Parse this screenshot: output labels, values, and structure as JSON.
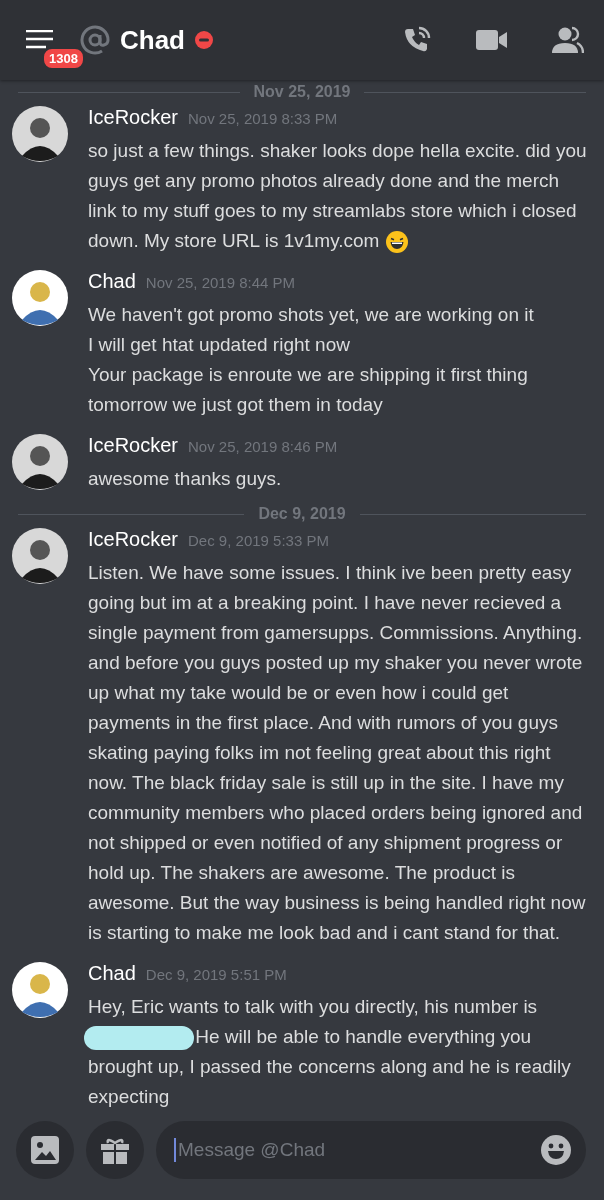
{
  "header": {
    "badge": "1308",
    "title": "Chad",
    "status": {
      "kind": "dnd"
    }
  },
  "feed": [
    {
      "kind": "date",
      "label": "Nov 25, 2019"
    },
    {
      "kind": "message",
      "author": "IceRocker",
      "avatar": {
        "kind": "grayscale"
      },
      "time": "Nov 25, 2019 8:33 PM",
      "lines": [
        [
          {
            "kind": "text",
            "text": "so just a few things. shaker looks dope hella excite. did you guys get any promo photos already done and the merch link to my stuff goes to my streamlabs store which i closed down. My store URL is 1v1my.com"
          },
          {
            "kind": "emoji"
          }
        ]
      ]
    },
    {
      "kind": "message",
      "author": "Chad",
      "avatar": {
        "kind": "color"
      },
      "time": "Nov 25, 2019 8:44 PM",
      "lines": [
        [
          {
            "kind": "text",
            "text": "We haven't got promo shots yet, we are working on it"
          }
        ],
        [
          {
            "kind": "text",
            "text": "I will get htat updated right now"
          }
        ],
        [
          {
            "kind": "text",
            "text": "Your package is enroute we are shipping it first thing tomorrow we just got them in today"
          }
        ]
      ]
    },
    {
      "kind": "message",
      "author": "IceRocker",
      "avatar": {
        "kind": "grayscale"
      },
      "time": "Nov 25, 2019 8:46 PM",
      "lines": [
        [
          {
            "kind": "text",
            "text": "awesome thanks guys."
          }
        ]
      ]
    },
    {
      "kind": "date",
      "label": "Dec 9, 2019"
    },
    {
      "kind": "message",
      "author": "IceRocker",
      "avatar": {
        "kind": "grayscale"
      },
      "time": "Dec 9, 2019 5:33 PM",
      "lines": [
        [
          {
            "kind": "text",
            "text": "Listen. We have some issues. I think ive been pretty easy going but im at a breaking point. I have never recieved a single payment from gamersupps. Commissions. Anything. and before you guys posted up my shaker you never wrote up what my take would be or even how i could get payments in the first place. And with rumors of you guys skating paying folks im not feeling great about this right now. The black friday sale is still up in the site. I have my community members who placed orders being ignored and not shipped or even notified of any shipment progress or hold up. The shakers are awesome. The product is awesome. But the way business is being handled right now is starting to make me look bad and i cant stand for that."
          }
        ]
      ]
    },
    {
      "kind": "message",
      "author": "Chad",
      "avatar": {
        "kind": "color"
      },
      "time": "Dec 9, 2019 5:51 PM",
      "lines": [
        [
          {
            "kind": "text",
            "text": "Hey, Eric wants to talk with you directly, his number is"
          },
          {
            "kind": "redacted"
          },
          {
            "kind": "text",
            "text": "He will be able to handle everything you brought up, I passed the concerns along and he is readily expecting"
          }
        ]
      ]
    }
  ],
  "composer": {
    "placeholder": "Message @Chad"
  }
}
